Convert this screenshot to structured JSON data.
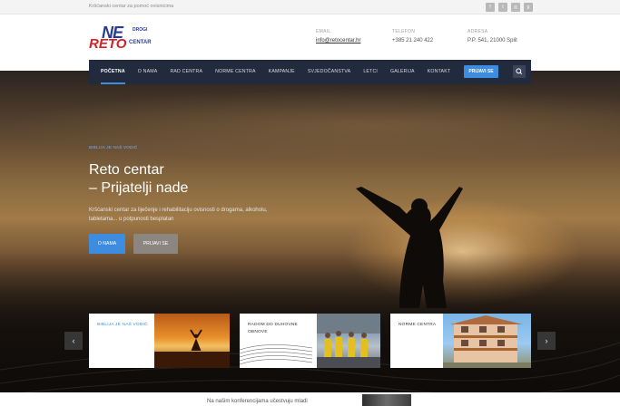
{
  "topbar": {
    "tagline": "Kršćanski centar za pomoć ovisnicima",
    "socials": [
      {
        "icon": "facebook-icon",
        "glyph": "f"
      },
      {
        "icon": "twitter-icon",
        "glyph": "t"
      },
      {
        "icon": "instagram-icon",
        "glyph": "◎"
      },
      {
        "icon": "google-plus-icon",
        "glyph": "g"
      }
    ]
  },
  "logo": {
    "line1": "NE",
    "line1_small": "DROGI",
    "line2": "RETO",
    "line2_small": "CENTAR"
  },
  "contact": {
    "email_label": "EMAIL",
    "email_value": "info@retocentar.hr",
    "phone_label": "TELEFON",
    "phone_value": "+385 21 240 422",
    "address_label": "ADRESA",
    "address_value": "P.P. 541, 21000 Split"
  },
  "nav": {
    "items": [
      "POČETNA",
      "O NAMA",
      "RAD CENTRA",
      "NORME CENTRA",
      "KAMPANJE",
      "SVJEDOČANSTVA",
      "LETCI",
      "GALERIJA",
      "KONTAKT"
    ],
    "cta": "PRIJAVI SE"
  },
  "hero": {
    "small": "BIBLIJA JE NAŠ VODIČ",
    "title_line1": "Reto centar",
    "title_line2": "– Prijatelji nade",
    "description": "Kršćanski centar za liječenje i rehabilitaciju ovisnosti o drogama, alkoholu, tabletama... u potpunosti besplatan",
    "button_primary": "O NAMA",
    "button_secondary": "PRIJAVI SE"
  },
  "cards": [
    {
      "title": "BIBLIJA JE NAŠ VODIČ"
    },
    {
      "title": "RADOM DO DUHOVNE OBNOVE"
    },
    {
      "title": "NORME CENTRA"
    }
  ],
  "bottom": {
    "text": "Na našim konferencijama učestvuju mladi"
  },
  "colors": {
    "accent": "#3d8ce0",
    "nav_bg": "#222a3d",
    "logo_blue": "#2a3c8e",
    "logo_red": "#d42027"
  }
}
